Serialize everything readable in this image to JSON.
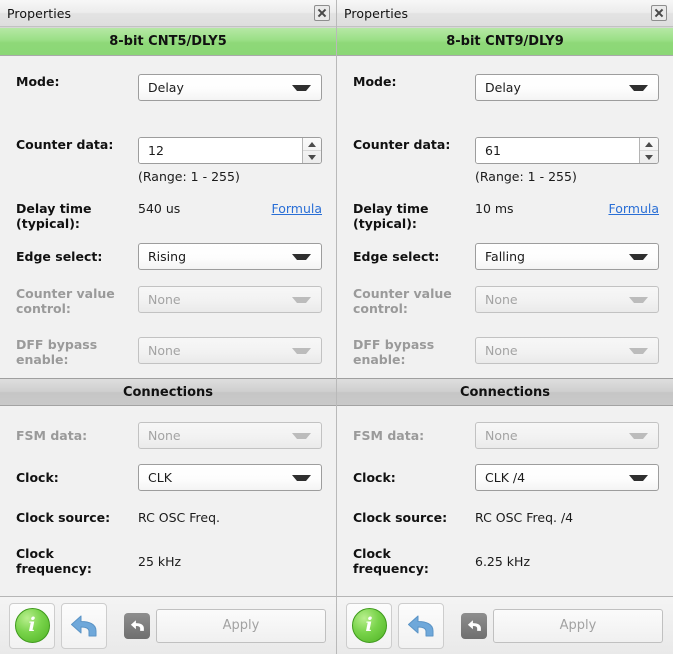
{
  "panels": [
    {
      "titlebar": {
        "title": "Properties",
        "close_icon": "close-icon"
      },
      "header": "8-bit CNT5/DLY5",
      "mode": {
        "label": "Mode:",
        "value": "Delay"
      },
      "counter_data": {
        "label": "Counter data:",
        "value": "12",
        "range_hint": "(Range:  1 - 255)"
      },
      "delay_time": {
        "label": "Delay time\n(typical):",
        "label_line1": "Delay time",
        "label_line2": "(typical):",
        "value": "540 us",
        "formula_link": "Formula"
      },
      "edge_select": {
        "label": "Edge select:",
        "value": "Rising"
      },
      "counter_value_control": {
        "label_line1": "Counter value",
        "label_line2": "control:",
        "value": "None"
      },
      "dff_bypass": {
        "label_line1": "DFF bypass",
        "label_line2": "enable:",
        "value": "None"
      },
      "connections_header": "Connections",
      "fsm_data": {
        "label": "FSM data:",
        "value": "None"
      },
      "clock": {
        "label": "Clock:",
        "value": "CLK"
      },
      "clock_source": {
        "label": "Clock source:",
        "value": "RC OSC Freq."
      },
      "clock_frequency": {
        "label_line1": "Clock",
        "label_line2": "frequency:",
        "value": "25 kHz"
      },
      "footer": {
        "info_glyph": "i",
        "info_icon": "info-icon",
        "undo_icon": "undo-icon",
        "revert_icon": "revert-icon",
        "apply_label": "Apply"
      }
    },
    {
      "titlebar": {
        "title": "Properties",
        "close_icon": "close-icon"
      },
      "header": "8-bit CNT9/DLY9",
      "mode": {
        "label": "Mode:",
        "value": "Delay"
      },
      "counter_data": {
        "label": "Counter data:",
        "value": "61",
        "range_hint": "(Range:  1 - 255)"
      },
      "delay_time": {
        "label_line1": "Delay time",
        "label_line2": "(typical):",
        "value": "10 ms",
        "formula_link": "Formula"
      },
      "edge_select": {
        "label": "Edge select:",
        "value": "Falling"
      },
      "counter_value_control": {
        "label_line1": "Counter value",
        "label_line2": "control:",
        "value": "None"
      },
      "dff_bypass": {
        "label_line1": "DFF bypass",
        "label_line2": "enable:",
        "value": "None"
      },
      "connections_header": "Connections",
      "fsm_data": {
        "label": "FSM data:",
        "value": "None"
      },
      "clock": {
        "label": "Clock:",
        "value": "CLK /4"
      },
      "clock_source": {
        "label": "Clock source:",
        "value": "RC OSC Freq. /4"
      },
      "clock_frequency": {
        "label_line1": "Clock",
        "label_line2": "frequency:",
        "value": "6.25 kHz"
      },
      "footer": {
        "info_glyph": "i",
        "info_icon": "info-icon",
        "undo_icon": "undo-icon",
        "revert_icon": "revert-icon",
        "apply_label": "Apply"
      }
    }
  ],
  "colors": {
    "header_green": "#8ed878",
    "header_grey": "#cfcfcf",
    "link_blue": "#2a6fd6",
    "info_green": "#78d34a",
    "undo_blue": "#6fa8da",
    "disabled_text": "#a3a3a3"
  }
}
